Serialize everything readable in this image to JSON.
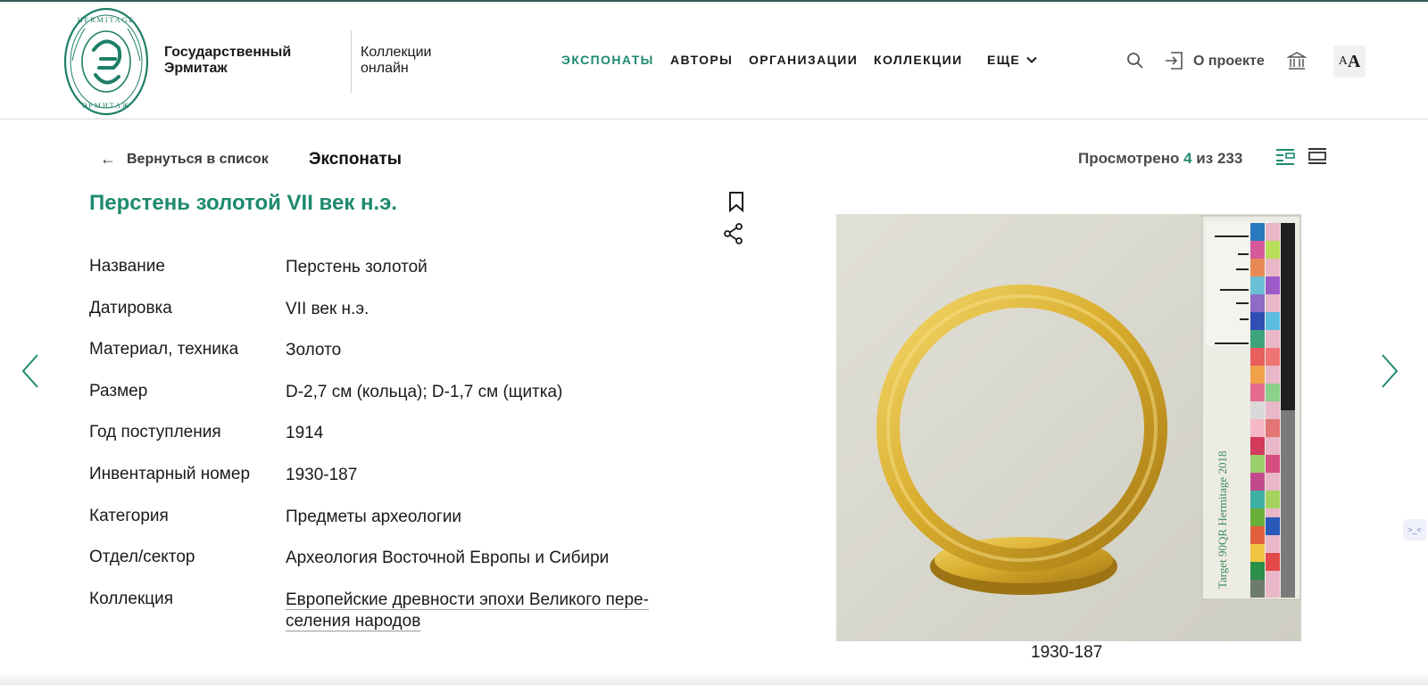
{
  "header": {
    "logo_text": "HERMITAGE ЭРМИТАЖ",
    "brand_line1": "Государственный",
    "brand_line2": "Эрмитаж",
    "collections_line1": "Коллекции",
    "collections_line2": "онлайн",
    "nav": [
      {
        "label": "ЭКСПОНАТЫ",
        "active": true
      },
      {
        "label": "АВТОРЫ",
        "active": false
      },
      {
        "label": "ОРГАНИЗАЦИИ",
        "active": false
      },
      {
        "label": "КОЛЛЕКЦИИ",
        "active": false
      },
      {
        "label": "ЕЩЕ",
        "active": false
      }
    ],
    "about_label": "О проекте",
    "font_toggle_small": "A",
    "font_toggle_big": "A"
  },
  "subheader": {
    "back_label": "Вернуться в список",
    "section_title": "Экспонаты",
    "viewed_prefix": "Просмотрено",
    "viewed_current": "4",
    "viewed_middle": "из",
    "viewed_total": "233"
  },
  "object": {
    "title": "Перстень золотой VII век н.э.",
    "fields": [
      {
        "key": "Название",
        "value": "Перстень золотой"
      },
      {
        "key": "Датировка",
        "value": "VII век н.э."
      },
      {
        "key": "Материал, техника",
        "value": "Золото"
      },
      {
        "key": "Размер",
        "value": "D-2,7 см (кольца); D-1,7 см (щитка)"
      },
      {
        "key": "Год поступления",
        "value": "1914"
      },
      {
        "key": "Инвентарный номер",
        "value": "1930-187"
      },
      {
        "key": "Категория",
        "value": "Предметы археологии"
      },
      {
        "key": "Отдел/сектор",
        "value": "Археология Восточной Европы и Сибири"
      },
      {
        "key": "Коллекция",
        "value_line1": "Европейские древности эпохи Великого пере-",
        "value_line2": "селения народов"
      }
    ],
    "image_caption": "1930-187",
    "photo_target_text": "Target 90QR Hermitage 2018"
  },
  "widget": {
    "label": ">_<"
  },
  "colors": {
    "accent": "#1e8a6f",
    "text": "#1a1a1a",
    "gold": "#d4aa2a"
  }
}
